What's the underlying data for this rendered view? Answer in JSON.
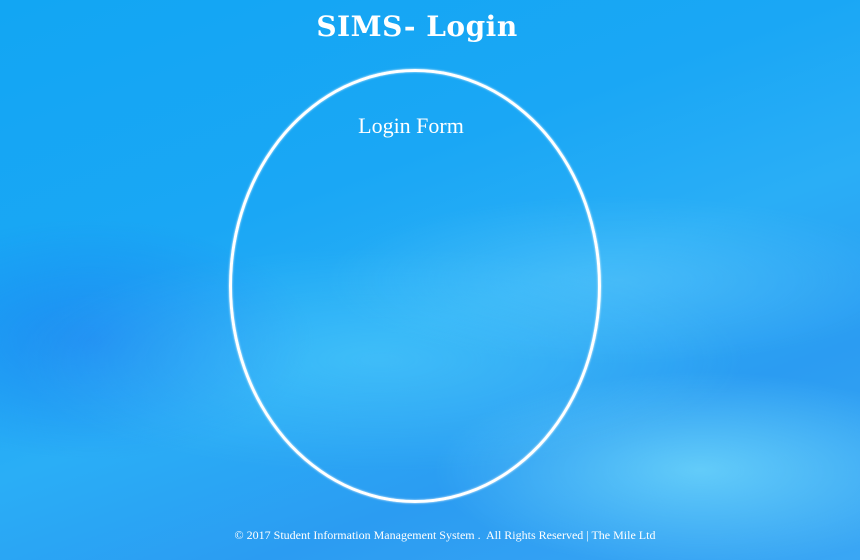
{
  "header": {
    "title": "SIMS- Login"
  },
  "login_form": {
    "title": "Login Form"
  },
  "footer": {
    "text": "© 2017 Student Information Management System .  All Rights Reserved | The Mile Ltd"
  },
  "colors": {
    "background": "#1aa7f5",
    "text": "#ffffff",
    "ring": "#ffffff"
  }
}
